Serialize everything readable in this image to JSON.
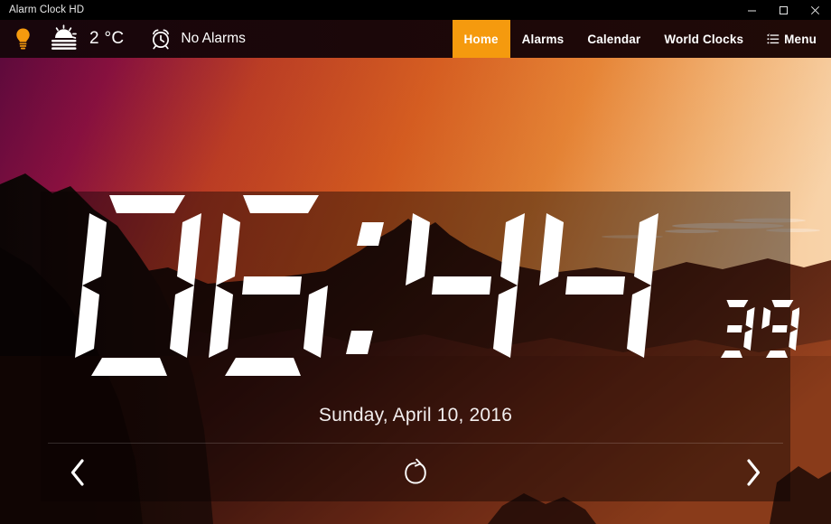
{
  "window": {
    "title": "Alarm Clock HD",
    "controls": [
      {
        "name": "minimize",
        "glyph": "minimize-icon"
      },
      {
        "name": "maximize",
        "glyph": "maximize-icon"
      },
      {
        "name": "close",
        "glyph": "close-icon"
      }
    ]
  },
  "toolbar": {
    "bulb_icon": "lightbulb-icon",
    "bulb_color": "#f59a0e",
    "weather": {
      "icon": "sun-fog-icon",
      "temperature": "2 °C"
    },
    "alarms": {
      "icon": "alarm-clock-icon",
      "label": "No Alarms"
    },
    "nav": [
      {
        "label": "Home",
        "active": true
      },
      {
        "label": "Alarms",
        "active": false
      },
      {
        "label": "Calendar",
        "active": false
      },
      {
        "label": "World Clocks",
        "active": false
      },
      {
        "label": "Menu",
        "active": false,
        "icon": "hamburger-menu-icon"
      }
    ],
    "accent_color": "#f59a0e",
    "background_color": "#1b0709"
  },
  "clock": {
    "hours": "06",
    "minutes": "44",
    "seconds": "39",
    "separator": ":",
    "date": "Sunday, April 10, 2016",
    "digit_color": "#ffffff"
  },
  "controls": {
    "previous": "chevron-left-icon",
    "refresh": "refresh-icon",
    "next": "chevron-right-icon"
  },
  "wallpaper": {
    "description": "sunset-mountain-landscape",
    "sky_left": "#7c0d44",
    "sky_mid": "#d9541b",
    "sky_right": "#f0c79a",
    "ground": "#2a110c"
  }
}
